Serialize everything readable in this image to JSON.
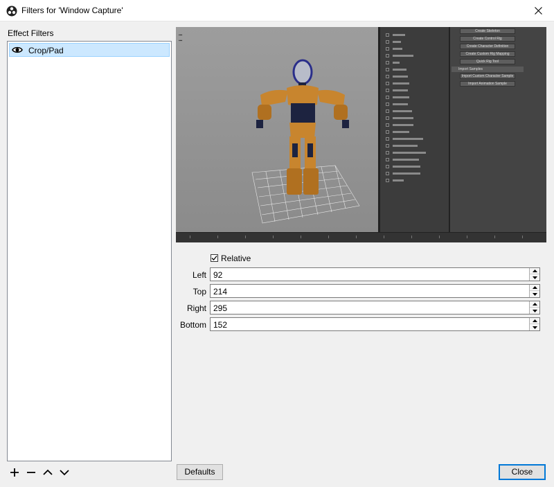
{
  "window": {
    "title": "Filters for 'Window Capture'",
    "close_glyph": "✕"
  },
  "filters_panel": {
    "label": "Effect Filters",
    "items": [
      {
        "name": "Crop/Pad",
        "visible": true,
        "icon": "eye-icon"
      }
    ],
    "tools": {
      "add": "+",
      "remove": "−",
      "up_icon": "chevron-up-icon",
      "down_icon": "chevron-down-icon"
    }
  },
  "properties": {
    "relative": {
      "label": "Relative",
      "checked": true
    },
    "fields": [
      {
        "label": "Left",
        "value": "92"
      },
      {
        "label": "Top",
        "value": "214"
      },
      {
        "label": "Right",
        "value": "295"
      },
      {
        "label": "Bottom",
        "value": "152"
      }
    ]
  },
  "buttons": {
    "defaults": "Defaults",
    "close": "Close"
  },
  "preview": {
    "panel_buttons": [
      "Create Skeleton",
      "Create Control Rig",
      "Create Character Definition",
      "Create Custom Rig Mapping",
      "Quick Rig Tool",
      "Import Custom Character Sample",
      "Import Animation Sample"
    ],
    "panel_header": "Import Samples"
  },
  "colors": {
    "selection": "#cce8ff",
    "accent": "#0078d7",
    "character_orange": "#c8852e",
    "character_navy": "#1d2340"
  }
}
